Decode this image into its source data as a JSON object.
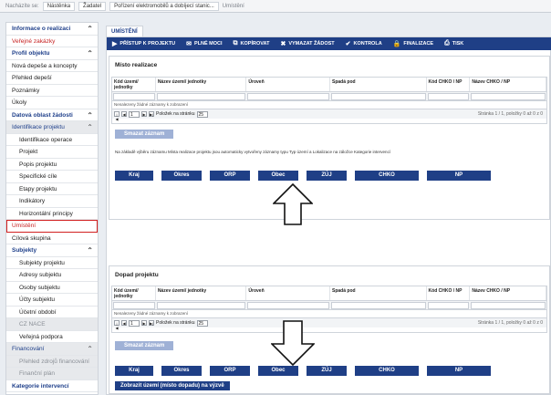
{
  "breadcrumb": {
    "here_label": "Nacházíte se:",
    "items": [
      "Nástěnka",
      "Žadatel",
      "Pořízení elektromobilů a dobíjecí stanic...",
      "Umístění"
    ]
  },
  "sidebar": {
    "items": [
      {
        "label": "Informace o realizaci",
        "kind": "head",
        "chev": "⌃"
      },
      {
        "label": "Veřejné zakázky",
        "kind": "red"
      },
      {
        "label": "Profil objektu",
        "kind": "head",
        "chev": "⌃"
      },
      {
        "label": "Nová depeše a koncepty",
        "kind": "plain"
      },
      {
        "label": "Přehled depeší",
        "kind": "plain"
      },
      {
        "label": "Poznámky",
        "kind": "plain"
      },
      {
        "label": "Úkoly",
        "kind": "plain"
      },
      {
        "label": "Datová oblast žádosti",
        "kind": "head",
        "chev": "⌃"
      },
      {
        "label": "Identifikace projektu",
        "kind": "grayhead",
        "chev": "⌃"
      },
      {
        "label": "Identifikace operace",
        "kind": "sub"
      },
      {
        "label": "Projekt",
        "kind": "sub"
      },
      {
        "label": "Popis projektu",
        "kind": "sub"
      },
      {
        "label": "Specifické cíle",
        "kind": "sub"
      },
      {
        "label": "Etapy projektu",
        "kind": "sub"
      },
      {
        "label": "Indikátory",
        "kind": "sub"
      },
      {
        "label": "Horizontální principy",
        "kind": "sub"
      },
      {
        "label": "Umístění",
        "kind": "selected"
      },
      {
        "label": "Cílová skupina",
        "kind": "plain"
      },
      {
        "label": "Subjekty",
        "kind": "head",
        "chev": "⌃"
      },
      {
        "label": "Subjekty projektu",
        "kind": "sub"
      },
      {
        "label": "Adresy subjektu",
        "kind": "sub"
      },
      {
        "label": "Osoby subjektu",
        "kind": "sub"
      },
      {
        "label": "Účty subjektu",
        "kind": "sub"
      },
      {
        "label": "Účetní období",
        "kind": "sub"
      },
      {
        "label": "CZ NACE",
        "kind": "subgray"
      },
      {
        "label": "Veřejná podpora",
        "kind": "sub"
      },
      {
        "label": "Financování",
        "kind": "grayhead",
        "chev": "⌃"
      },
      {
        "label": "Přehled zdrojů financování",
        "kind": "subgray"
      },
      {
        "label": "Finanční plán",
        "kind": "subgray"
      },
      {
        "label": "Kategorie intervencí",
        "kind": "head"
      }
    ]
  },
  "tab_label": "UMÍSTĚNÍ",
  "toolbar": [
    {
      "icon": "▶",
      "icon_name": "play-icon",
      "label": "PŘÍSTUP K PROJEKTU"
    },
    {
      "icon": "✉",
      "icon_name": "envelope-icon",
      "label": "PLNÉ MOCI"
    },
    {
      "icon": "⧉",
      "icon_name": "copy-icon",
      "label": "KOPÍROVAT"
    },
    {
      "icon": "✖",
      "icon_name": "delete-icon",
      "label": "VYMAZAT ŽÁDOST"
    },
    {
      "icon": "✔",
      "icon_name": "check-icon",
      "label": "KONTROLA"
    },
    {
      "icon": "🔒",
      "icon_name": "lock-icon",
      "label": "FINALIZACE"
    },
    {
      "icon": "⎙",
      "icon_name": "print-icon",
      "label": "TISK"
    }
  ],
  "mista": {
    "title": "Místo realizace",
    "columns": [
      "Kód území/ jednotky",
      "Název území/ jednotky",
      "Úroveň",
      "Spadá pod",
      "Kód CHKO / NP",
      "Název CHKO / NP"
    ],
    "empty_note": "Nenalezeny žádné záznamy k zobrazení",
    "page_num": "1",
    "per_page_label": "Položek na stránku",
    "per_page": "25",
    "page_info": "Stránka 1 / 1, položky 0 až 0 z 0",
    "delete_label": "Smazat záznam",
    "info_text": "Na základě výběru záznamu Místa realizace projektu jsou automaticky vytvořeny záznamy typu Typ území a Lokalizace na záložce Kategorie intervencí",
    "buttons": [
      "Kraj",
      "Okres",
      "ORP",
      "Obec",
      "ZÚJ",
      "CHKO",
      "NP"
    ]
  },
  "dopad": {
    "title": "Dopad projektu",
    "columns": [
      "Kód území/ jednotky",
      "Název území/ jednotky",
      "Úroveň",
      "Spadá pod",
      "Kód CHKO / NP",
      "Název CHKO / NP"
    ],
    "empty_note": "Nenalezeny žádné záznamy k zobrazení",
    "page_num": "1",
    "per_page_label": "Položek na stránku",
    "per_page": "25",
    "page_info": "Stránka 1 / 1, položky 0 až 0 z 0",
    "delete_label": "Smazat záznam",
    "buttons": [
      "Kraj",
      "Okres",
      "ORP",
      "Obec",
      "ZÚJ",
      "CHKO",
      "NP"
    ],
    "show_label": "Zobrazit území (místo dopadu) na výzvě"
  },
  "pager_icons": {
    "first": "|◀",
    "prev": "◀",
    "next": "▶",
    "last": "▶|"
  },
  "colors": {
    "primary": "#1f3f86",
    "selected_border": "#d21f1f",
    "disabled_button": "#9fb1d6"
  }
}
